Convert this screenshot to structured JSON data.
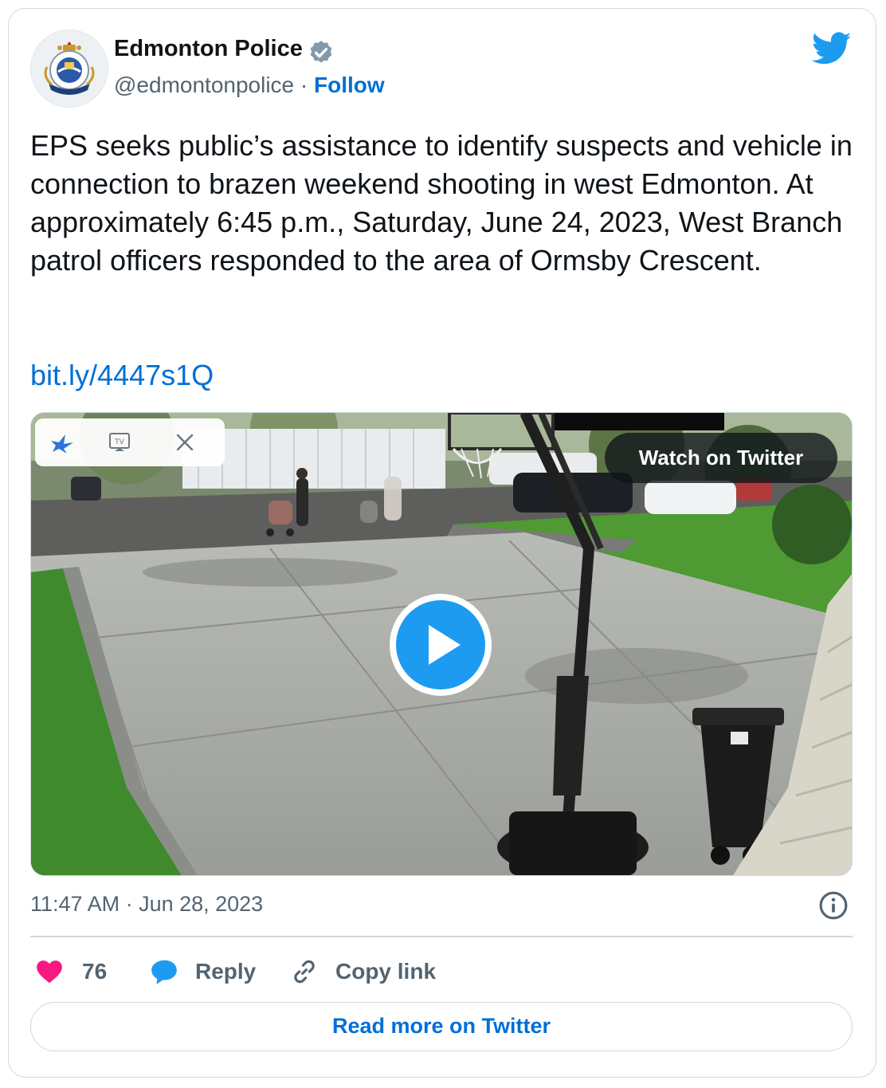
{
  "author": {
    "display_name": "Edmonton Police",
    "handle": "@edmontonpolice",
    "separator": "·",
    "follow_label": "Follow",
    "verified_icon": "verified-badge-icon",
    "avatar_icon": "police-crest-logo"
  },
  "tweet": {
    "text": "EPS seeks public’s assistance to identify suspects and vehicle in connection to brazen weekend shooting in west Edmonton. At approximately 6:45 p.m., Saturday, June 24, 2023, West Branch patrol officers responded to the area of Ormsby Crescent.",
    "link": "bit.ly/4447s1Q"
  },
  "media": {
    "watch_label": "Watch on Twitter",
    "play_icon": "play-icon",
    "pip_icons": [
      "bird-icon",
      "tv-icon",
      "close-icon"
    ]
  },
  "timestamp": "11:47 AM · Jun 28, 2023",
  "actions": {
    "likes": "76",
    "reply_label": "Reply",
    "copy_label": "Copy link"
  },
  "read_more_label": "Read more on Twitter",
  "colors": {
    "accent": "#1d9bf0",
    "link": "#006fd6",
    "like": "#f91880",
    "text": "#0f1419",
    "muted": "#536471",
    "border": "#cfd9de"
  }
}
